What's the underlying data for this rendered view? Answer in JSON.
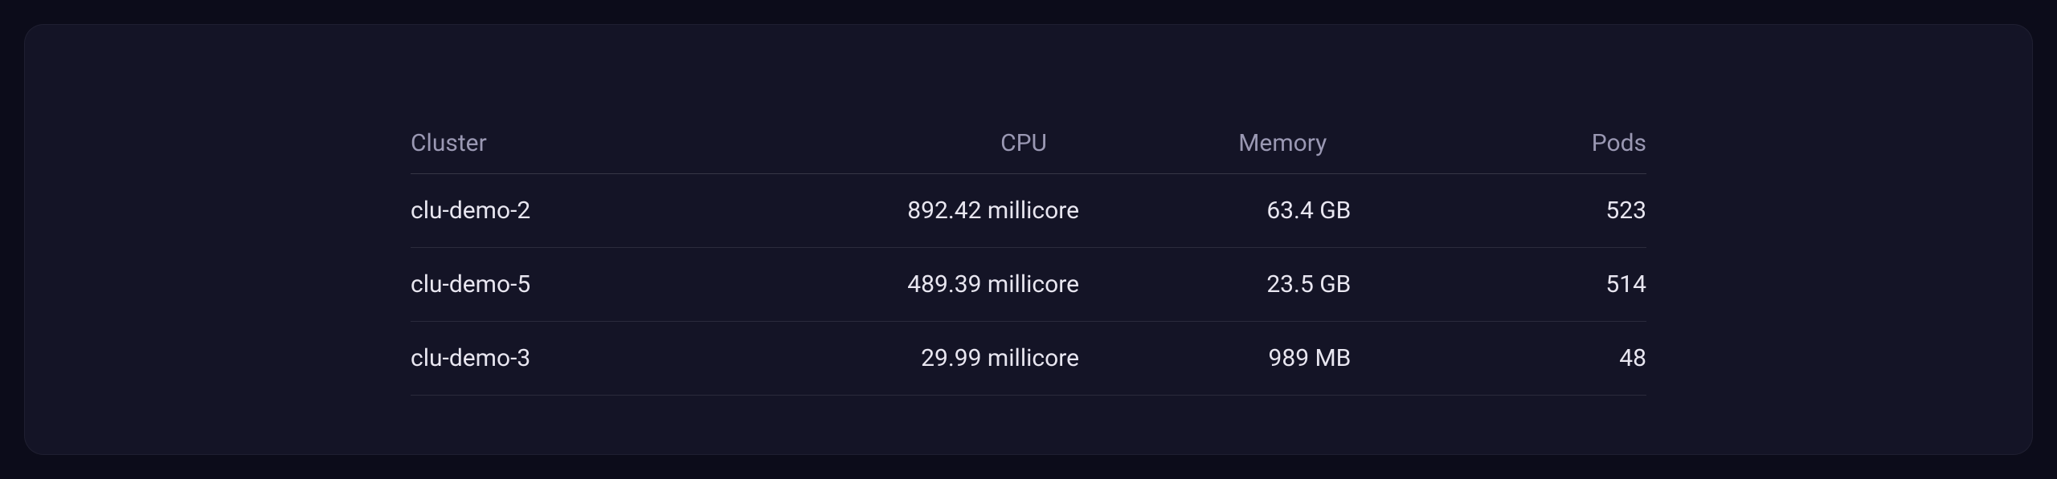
{
  "table": {
    "headers": {
      "cluster": "Cluster",
      "cpu": "CPU",
      "memory": "Memory",
      "pods": "Pods"
    },
    "rows": [
      {
        "cluster": "clu-demo-2",
        "cpu": "892.42 millicore",
        "memory": "63.4 GB",
        "pods": "523"
      },
      {
        "cluster": "clu-demo-5",
        "cpu": "489.39 millicore",
        "memory": "23.5 GB",
        "pods": "514"
      },
      {
        "cluster": "clu-demo-3",
        "cpu": "29.99 millicore",
        "memory": "989 MB",
        "pods": "48"
      }
    ]
  }
}
